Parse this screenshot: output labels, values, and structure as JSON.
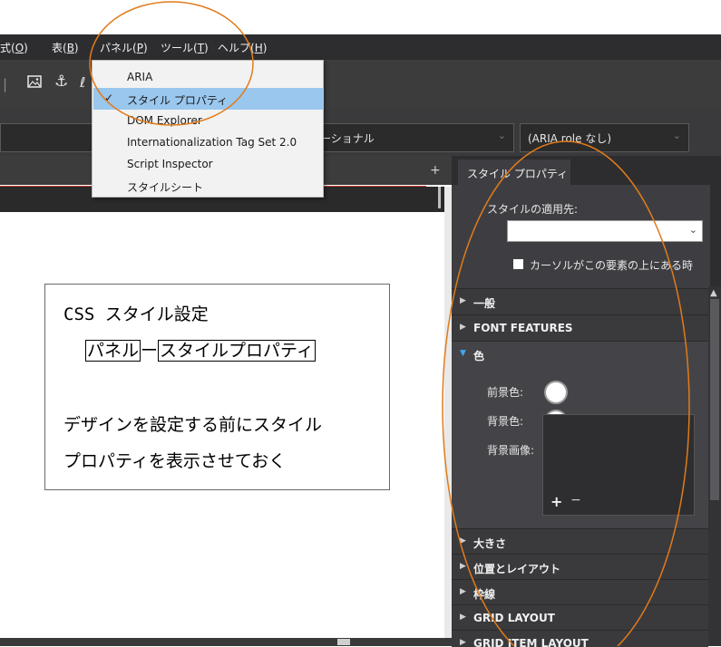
{
  "menubar": {
    "items": [
      {
        "label": "式(",
        "key": "O",
        "close": ")"
      },
      {
        "label": "表(",
        "key": "B",
        "close": ")"
      },
      {
        "label": "パネル(",
        "key": "P",
        "close": ")"
      },
      {
        "label": "ツール(",
        "key": "T",
        "close": ")"
      },
      {
        "label": "ヘルプ(",
        "key": "H",
        "close": ")"
      }
    ]
  },
  "toolbar": {
    "icons": [
      "image-icon",
      "anchor-icon",
      "link-icon"
    ]
  },
  "panel_menu": {
    "items": [
      {
        "label": "ARIA",
        "checked": false
      },
      {
        "label": "スタイル プロパティ",
        "checked": true
      },
      {
        "label": "DOM Explorer",
        "checked": false
      },
      {
        "label": "Internationalization Tag Set 2.0",
        "checked": false
      },
      {
        "label": "Script Inspector",
        "checked": false
      },
      {
        "label": "スタイルシート",
        "checked": false
      }
    ]
  },
  "properties_bar": {
    "font_select_value": "ロポーショナル",
    "aria_select_value": "(ARIA role なし)"
  },
  "doc_tabs": {
    "add_label": "+"
  },
  "style_panel": {
    "tab_label": "スタイル プロパティ",
    "apply_to_label": "スタイルの適用先:",
    "apply_to_value": "",
    "hover_checkbox_label": "カーソルがこの要素の上にある時",
    "sections": {
      "general": "一般",
      "font_features": "FONT FEATURES",
      "color": "色",
      "size": "大きさ",
      "position_layout": "位置とレイアウト",
      "border": "枠線",
      "grid_layout": "GRID LAYOUT",
      "grid_item_layout": "GRID ITEM LAYOUT"
    },
    "color_fields": {
      "foreground_label": "前景色:",
      "background_label": "背景色:",
      "background_image_label": "背景画像:",
      "add_label": "+",
      "remove_label": "−"
    }
  },
  "note": {
    "line1": "CSS スタイル設定",
    "menu_word": "パネル",
    "separator": "ー",
    "submenu_word": "スタイルプロパティ",
    "line3": "デザインを設定する前にスタイル",
    "line4": "プロパティを表示させておく"
  },
  "colors": {
    "annotation_orange": "#e07b1a",
    "menu_highlight": "#9ac7ee",
    "panel_dark": "#3e3e42"
  }
}
